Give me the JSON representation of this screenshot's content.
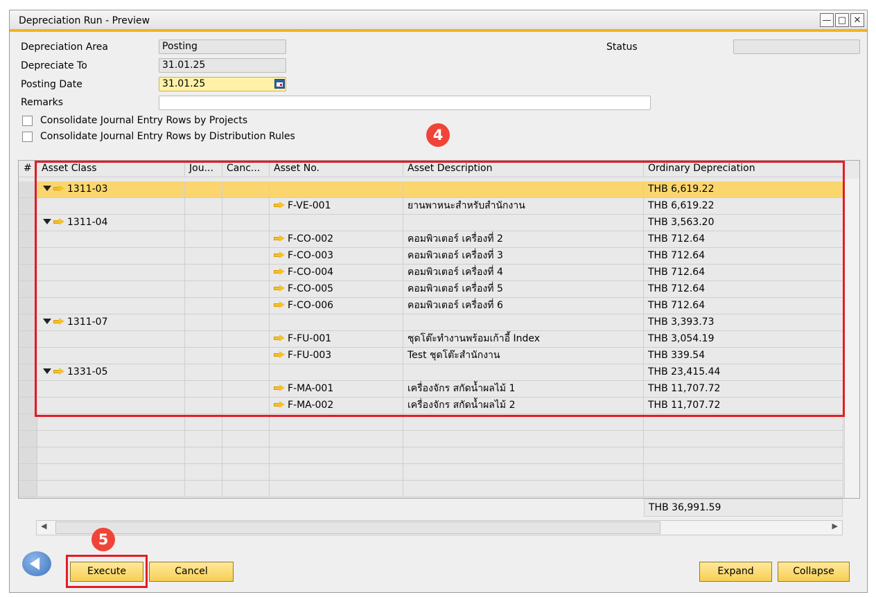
{
  "window": {
    "title": "Depreciation Run - Preview"
  },
  "form": {
    "depreciation_area_label": "Depreciation Area",
    "depreciation_area_value": "Posting",
    "depreciate_to_label": "Depreciate To",
    "depreciate_to_value": "31.01.25",
    "posting_date_label": "Posting Date",
    "posting_date_value": "31.01.25",
    "remarks_label": "Remarks",
    "remarks_value": "",
    "status_label": "Status",
    "status_value": "",
    "consolidate_projects_label": "Consolidate Journal Entry Rows by Projects",
    "consolidate_distribution_label": "Consolidate Journal Entry Rows by Distribution Rules"
  },
  "annotations": {
    "badge_grid": "4",
    "badge_execute": "5"
  },
  "grid": {
    "columns": [
      "#",
      "Asset Class",
      "Jou...",
      "Canc...",
      "Asset No.",
      "Asset Description",
      "Ordinary Depreciation"
    ],
    "rows": [
      {
        "type": "group",
        "asset_class": "1311-03",
        "asset_no": "",
        "description": "",
        "depreciation": "THB 6,619.22",
        "selected": true
      },
      {
        "type": "item",
        "asset_class": "",
        "asset_no": "F-VE-001",
        "description": "ยานพาหนะสำหรับสำนักงาน",
        "depreciation": "THB 6,619.22"
      },
      {
        "type": "group",
        "asset_class": "1311-04",
        "asset_no": "",
        "description": "",
        "depreciation": "THB 3,563.20"
      },
      {
        "type": "item",
        "asset_class": "",
        "asset_no": "F-CO-002",
        "description": "คอมพิวเตอร์ เครื่องที่ 2",
        "depreciation": "THB 712.64"
      },
      {
        "type": "item",
        "asset_class": "",
        "asset_no": "F-CO-003",
        "description": "คอมพิวเตอร์ เครื่องที่ 3",
        "depreciation": "THB 712.64"
      },
      {
        "type": "item",
        "asset_class": "",
        "asset_no": "F-CO-004",
        "description": "คอมพิวเตอร์ เครื่องที่ 4",
        "depreciation": "THB 712.64"
      },
      {
        "type": "item",
        "asset_class": "",
        "asset_no": "F-CO-005",
        "description": "คอมพิวเตอร์ เครื่องที่ 5",
        "depreciation": "THB 712.64"
      },
      {
        "type": "item",
        "asset_class": "",
        "asset_no": "F-CO-006",
        "description": "คอมพิวเตอร์ เครื่องที่ 6",
        "depreciation": "THB 712.64"
      },
      {
        "type": "group",
        "asset_class": "1311-07",
        "asset_no": "",
        "description": "",
        "depreciation": "THB 3,393.73"
      },
      {
        "type": "item",
        "asset_class": "",
        "asset_no": "F-FU-001",
        "description": "ชุดโต๊ะทำงานพร้อมเก้าอี้ Index",
        "depreciation": "THB 3,054.19"
      },
      {
        "type": "item",
        "asset_class": "",
        "asset_no": "F-FU-003",
        "description": "Test ชุดโต๊ะสำนักงาน",
        "depreciation": "THB 339.54"
      },
      {
        "type": "group",
        "asset_class": "1331-05",
        "asset_no": "",
        "description": "",
        "depreciation": "THB 23,415.44"
      },
      {
        "type": "item",
        "asset_class": "",
        "asset_no": "F-MA-001",
        "description": "เครื่องจักร สกัดน้ำผลไม้ 1",
        "depreciation": "THB 11,707.72"
      },
      {
        "type": "item",
        "asset_class": "",
        "asset_no": "F-MA-002",
        "description": "เครื่องจักร สกัดน้ำผลไม้ 2",
        "depreciation": "THB 11,707.72"
      }
    ],
    "total": "THB 36,991.59"
  },
  "buttons": {
    "execute": "Execute",
    "cancel": "Cancel",
    "expand": "Expand",
    "collapse": "Collapse"
  },
  "colors": {
    "accent": "#f5b31a",
    "selected_row": "#fbd66f",
    "highlight_box": "#e31b23",
    "badge": "#f04438"
  },
  "icons": {
    "minimize": "minimize-icon",
    "maximize": "maximize-icon",
    "close": "close-icon",
    "calendar": "calendar-icon",
    "back": "back-arrow-icon"
  }
}
